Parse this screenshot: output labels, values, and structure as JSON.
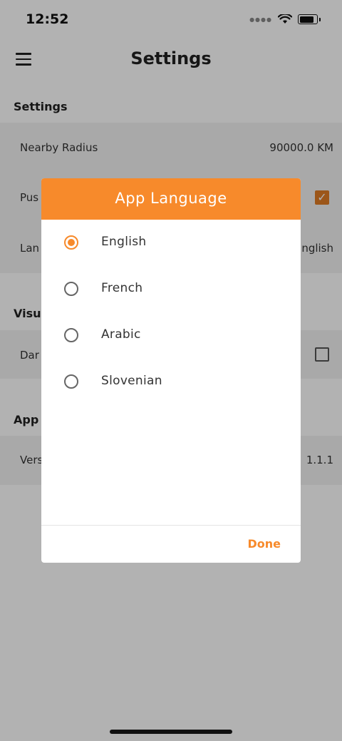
{
  "status_bar": {
    "time": "12:52"
  },
  "app_bar": {
    "title": "Settings"
  },
  "sections": {
    "settings": "Settings",
    "visual": "Visua",
    "app": "App"
  },
  "rows": {
    "nearby_radius": {
      "label": "Nearby Radius",
      "value": "90000.0 KM"
    },
    "push": {
      "label": "Pus",
      "checked": true
    },
    "language": {
      "label": "Lan",
      "value": "nglish"
    },
    "dark": {
      "label": "Dar",
      "checked": false
    },
    "version": {
      "label": "Vers",
      "value": "1.1.1"
    }
  },
  "dialog": {
    "title": "App Language",
    "options": [
      {
        "label": "English",
        "selected": true
      },
      {
        "label": "French",
        "selected": false
      },
      {
        "label": "Arabic",
        "selected": false
      },
      {
        "label": "Slovenian",
        "selected": false
      }
    ],
    "done_label": "Done"
  },
  "colors": {
    "accent": "#f78a2b",
    "checkbox_accent": "#e07b24"
  }
}
